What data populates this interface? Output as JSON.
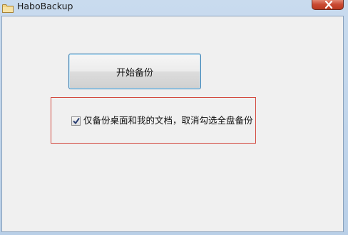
{
  "window": {
    "title": "HaboBackup",
    "app_icon": "folder-icon",
    "close_icon": "close-icon"
  },
  "main": {
    "start_button_label": "开始备份",
    "backup_option": {
      "checked": true,
      "label": "仅备份桌面和我的文档，取消勾选全盘备份"
    }
  },
  "colors": {
    "highlight_border": "#d34a3f",
    "button_border": "#3c7fb1",
    "close_button": "#c94a33"
  }
}
